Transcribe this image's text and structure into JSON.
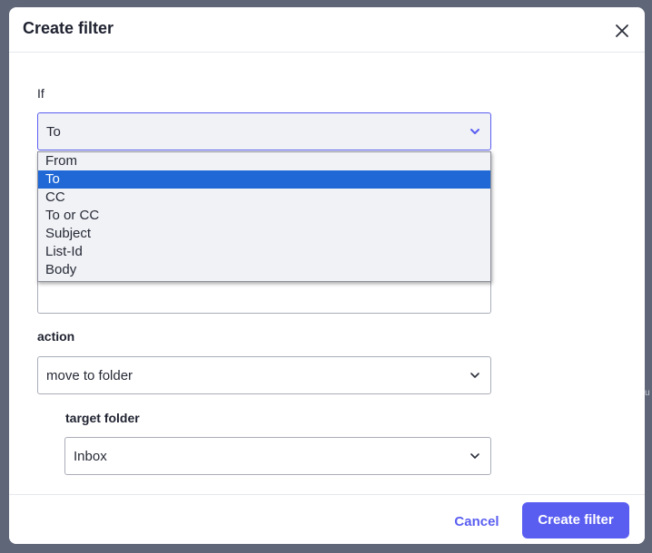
{
  "dialog": {
    "title": "Create filter",
    "close_icon": "close-icon"
  },
  "condition": {
    "label": "If",
    "field_select_value": "To",
    "field_options": [
      "From",
      "To",
      "CC",
      "To or CC",
      "Subject",
      "List-Id",
      "Body"
    ],
    "selected_option_index": 1,
    "value_input": ""
  },
  "action": {
    "label": "action",
    "select_value": "move to folder"
  },
  "target_folder": {
    "label": "target folder",
    "select_value": "Inbox"
  },
  "footer": {
    "cancel_label": "Cancel",
    "create_label": "Create filter"
  },
  "background_edge_text": "u",
  "colors": {
    "accent": "#5a5ef0",
    "selected_option": "#1f68d6",
    "overlay": "#5f6677"
  }
}
